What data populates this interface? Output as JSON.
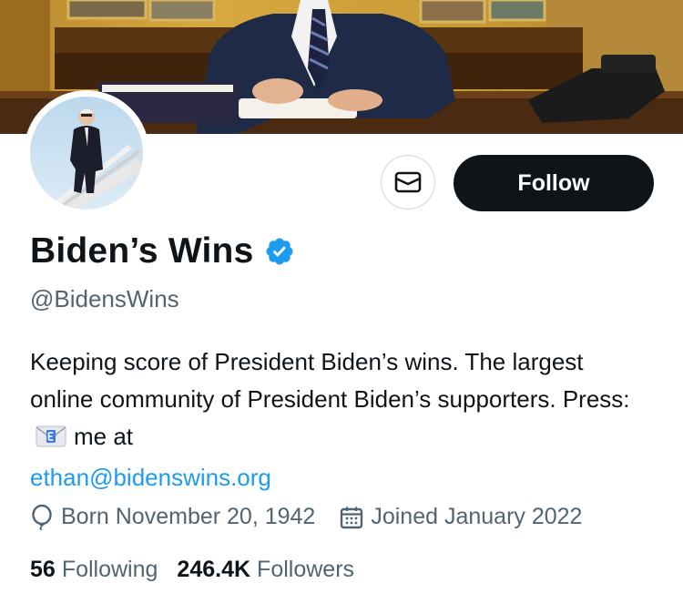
{
  "profile": {
    "display_name": "Biden’s Wins",
    "handle": "@BidensWins",
    "verified": true,
    "bio_line1": "Keeping score of President Biden’s wins. The largest online community of President Biden’s supporters. Press:",
    "bio_after_emoji": "me at",
    "bio_link": "ethan@bidenswins.org",
    "born": "Born November 20, 1942",
    "joined": "Joined January 2022"
  },
  "actions": {
    "message_icon": "envelope-icon",
    "follow_label": "Follow"
  },
  "stats": {
    "following_count": "56",
    "following_label": "Following",
    "followers_count": "246.4K",
    "followers_label": "Followers"
  },
  "colors": {
    "accent": "#1d9bf0",
    "text_primary": "#0f1419",
    "text_secondary": "#536471",
    "button_dark": "#0f1419"
  }
}
